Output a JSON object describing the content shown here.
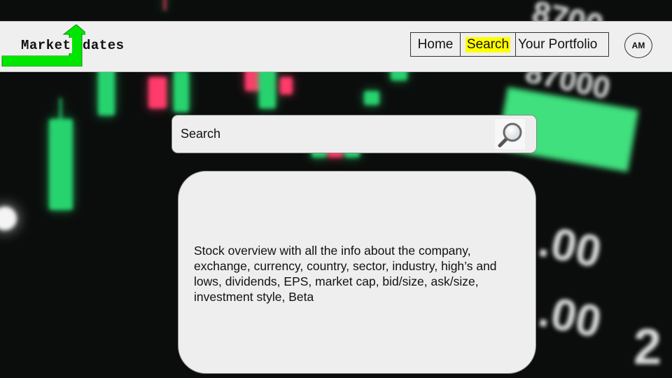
{
  "header": {
    "logo": {
      "left_text": "Market",
      "right_text": "dates",
      "accent_color": "#00e600"
    },
    "nav": {
      "items": [
        {
          "label": "Home",
          "active": false
        },
        {
          "label": "Search",
          "active": true
        },
        {
          "label": "Your Portfolio",
          "active": false
        }
      ],
      "highlight_color": "#ffff00"
    },
    "avatar": {
      "initials": "AM"
    }
  },
  "search": {
    "placeholder": "Search",
    "icon": "magnifier-icon"
  },
  "overview": {
    "text": "Stock overview with all the info about the company, exchange, currency, country, sector, industry, high’s and lows, dividends, EPS, market cap, bid/size, ask/size, investment style, Beta"
  }
}
